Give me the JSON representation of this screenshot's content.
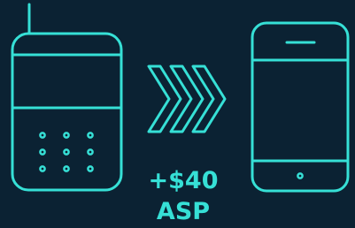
{
  "illustration": {
    "accent_color": "#36e0d6",
    "background_color": "#0b2233",
    "left_device": "feature-phone-icon",
    "arrows": "triple-chevron-right-icon",
    "right_device": "smartphone-icon"
  },
  "caption": {
    "price_delta": "+$40",
    "metric": "ASP"
  }
}
